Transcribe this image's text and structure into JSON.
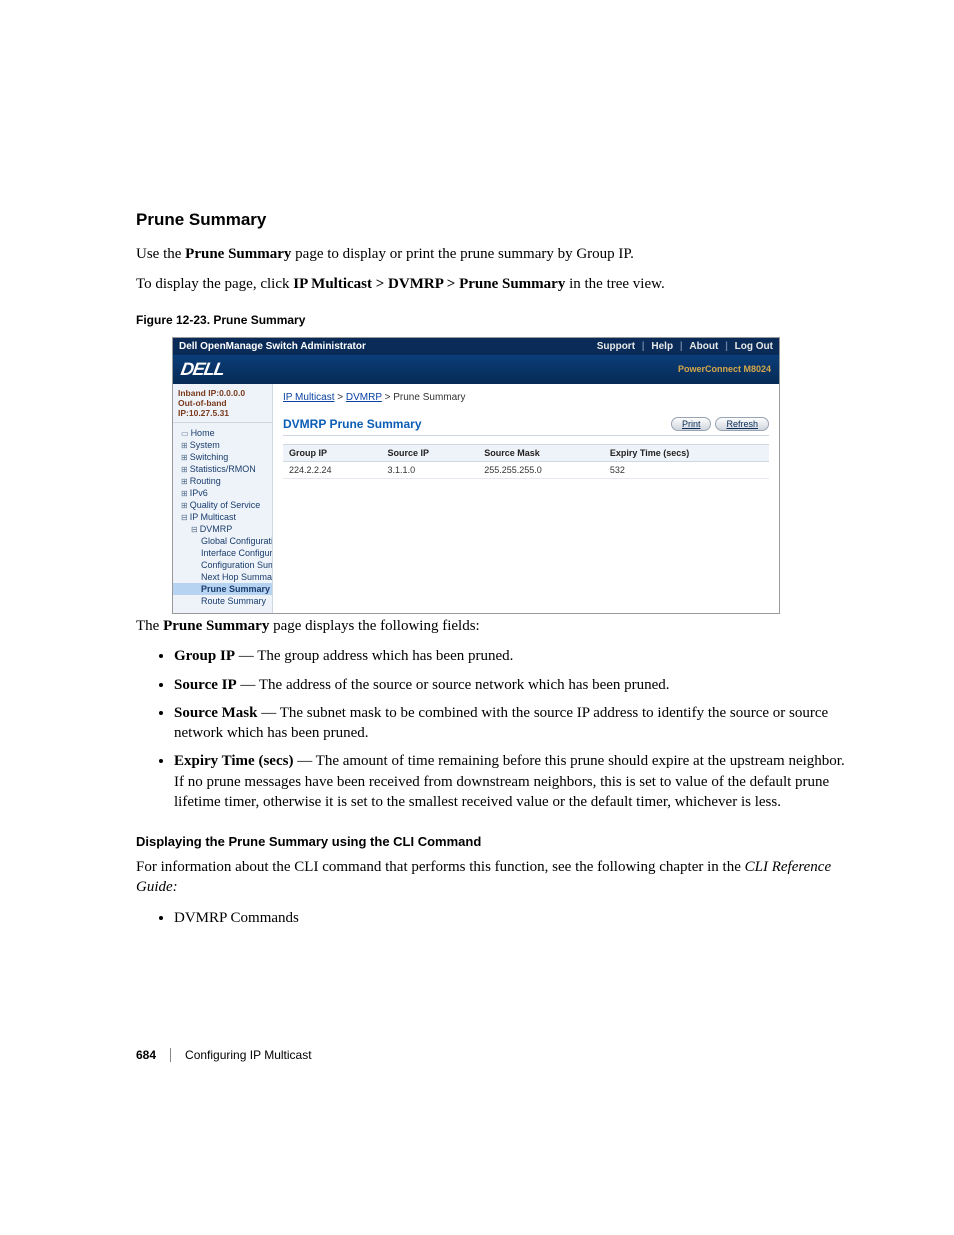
{
  "doc": {
    "section_title": "Prune Summary",
    "intro1_a": "Use the ",
    "intro1_b": "Prune Summary",
    "intro1_c": " page to display or print the prune summary by Group IP.",
    "intro2_a": "To display the page, click ",
    "intro2_b": "IP Multicast > DVMRP > Prune Summary",
    "intro2_c": " in the tree view.",
    "figure_caption": "Figure 12-23.    Prune Summary",
    "after_fig": "The ",
    "after_fig_b": "Prune Summary",
    "after_fig_c": " page displays the following fields:",
    "fields": [
      {
        "term": "Group IP",
        "desc": " — The group address which has been pruned."
      },
      {
        "term": "Source IP",
        "desc": " — The address of the source or source network which has been pruned."
      },
      {
        "term": "Source Mask",
        "desc": " — The subnet mask to be combined with the source IP address to identify the source or source network which has been pruned."
      },
      {
        "term": "Expiry Time (secs)",
        "desc": " — The amount of time remaining before this prune should expire at the upstream neighbor. If no prune messages have been received from downstream neighbors, this is set to value of the default prune lifetime timer, otherwise it is set to the smallest received value or the default timer, whichever is less."
      }
    ],
    "cli_heading": "Displaying the Prune Summary using the CLI Command",
    "cli_para_a": "For information about the CLI command that performs this function, see the following chapter in the ",
    "cli_para_b": "CLI Reference Guide:",
    "cli_bullet": "DVMRP Commands",
    "page_number": "684",
    "footer_text": "Configuring IP Multicast"
  },
  "ss": {
    "titlebar": "Dell OpenManage Switch Administrator",
    "top_links": [
      "Support",
      "Help",
      "About",
      "Log Out"
    ],
    "logo": "DELL",
    "product": "PowerConnect M8024",
    "ip1": "Inband IP:0.0.0.0",
    "ip2": "Out-of-band IP:10.27.5.31",
    "nav": [
      {
        "label": "Home",
        "level": 1,
        "glyph": "▭"
      },
      {
        "label": "System",
        "level": 1,
        "glyph": "⊞"
      },
      {
        "label": "Switching",
        "level": 1,
        "glyph": "⊞"
      },
      {
        "label": "Statistics/RMON",
        "level": 1,
        "glyph": "⊞"
      },
      {
        "label": "Routing",
        "level": 1,
        "glyph": "⊞"
      },
      {
        "label": "IPv6",
        "level": 1,
        "glyph": "⊞"
      },
      {
        "label": "Quality of Service",
        "level": 1,
        "glyph": "⊞"
      },
      {
        "label": "IP Multicast",
        "level": 1,
        "glyph": "⊟"
      },
      {
        "label": "DVMRP",
        "level": 2,
        "glyph": "⊟"
      },
      {
        "label": "Global Configuration",
        "level": 3,
        "glyph": ""
      },
      {
        "label": "Interface Configuration",
        "level": 3,
        "glyph": ""
      },
      {
        "label": "Configuration Summa",
        "level": 3,
        "glyph": ""
      },
      {
        "label": "Next Hop Summary",
        "level": 3,
        "glyph": ""
      },
      {
        "label": "Prune Summary",
        "level": 3,
        "glyph": "",
        "selected": true
      },
      {
        "label": "Route Summary",
        "level": 3,
        "glyph": ""
      }
    ],
    "breadcrumb": {
      "a1": "IP Multicast",
      "a2": "DVMRP",
      "tail": "Prune Summary"
    },
    "panel_title": "DVMRP Prune Summary",
    "buttons": {
      "print": "Print",
      "refresh": "Refresh"
    },
    "columns": [
      "Group IP",
      "Source IP",
      "Source Mask",
      "Expiry Time (secs)"
    ],
    "rows": [
      {
        "group_ip": "224.2.2.24",
        "source_ip": "3.1.1.0",
        "source_mask": "255.255.255.0",
        "expiry": "532"
      }
    ]
  }
}
